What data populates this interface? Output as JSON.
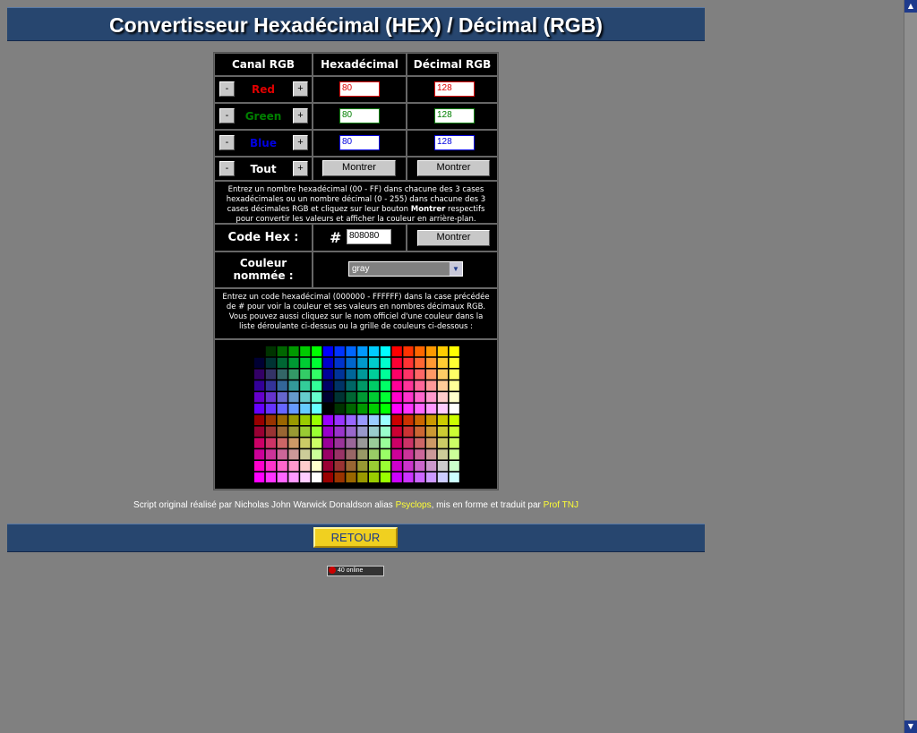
{
  "title": "Convertisseur Hexadécimal (HEX) / Décimal (RGB)",
  "headers": {
    "canal": "Canal RGB",
    "hex": "Hexadécimal",
    "dec": "Décimal RGB"
  },
  "buttons": {
    "minus": "-",
    "plus": "+",
    "montrer": "Montrer"
  },
  "channels": {
    "red": {
      "label": "Red",
      "color": "#e00000",
      "hex": "80",
      "dec": "128"
    },
    "green": {
      "label": "Green",
      "color": "#008000",
      "hex": "80",
      "dec": "128"
    },
    "blue": {
      "label": "Blue",
      "color": "#0000e0",
      "hex": "80",
      "dec": "128"
    },
    "tout": {
      "label": "Tout",
      "color": "#ffffff"
    }
  },
  "info1_part1": "Entrez un nombre hexadécimal (00 - FF) dans chacune des 3 cases hexadécimales ou un nombre décimal (0 - 255) dans chacune des 3 cases décimales RGB et cliquez sur leur bouton ",
  "info1_bold": "Montrer",
  "info1_part2": " respectifs pour convertir les valeurs et afficher la couleur en arrière-plan.",
  "code_hex": {
    "label": "Code Hex :",
    "hash": "#",
    "value": "808080"
  },
  "couleur_nommee": {
    "label_line1": "Couleur",
    "label_line2": "nommée :",
    "selected": "gray"
  },
  "info2": "Entrez un code hexadécimal (000000 - FFFFFF) dans la case précédée de # pour voir la couleur et ses valeurs en nombres décimaux RGB. Vous pouvez aussi cliquez sur le nom officiel d'une couleur dans la liste déroulante ci-dessus ou la grille de couleurs ci-dessous :",
  "credits": {
    "prefix": "Script original réalisé par Nicholas John Warwick Donaldson alias ",
    "author_link": "Psyclops",
    "middle": ", mis en forme et traduit par ",
    "translator_link": "Prof TNJ"
  },
  "retour": "RETOUR",
  "counter": {
    "value": "40",
    "label": "online"
  }
}
